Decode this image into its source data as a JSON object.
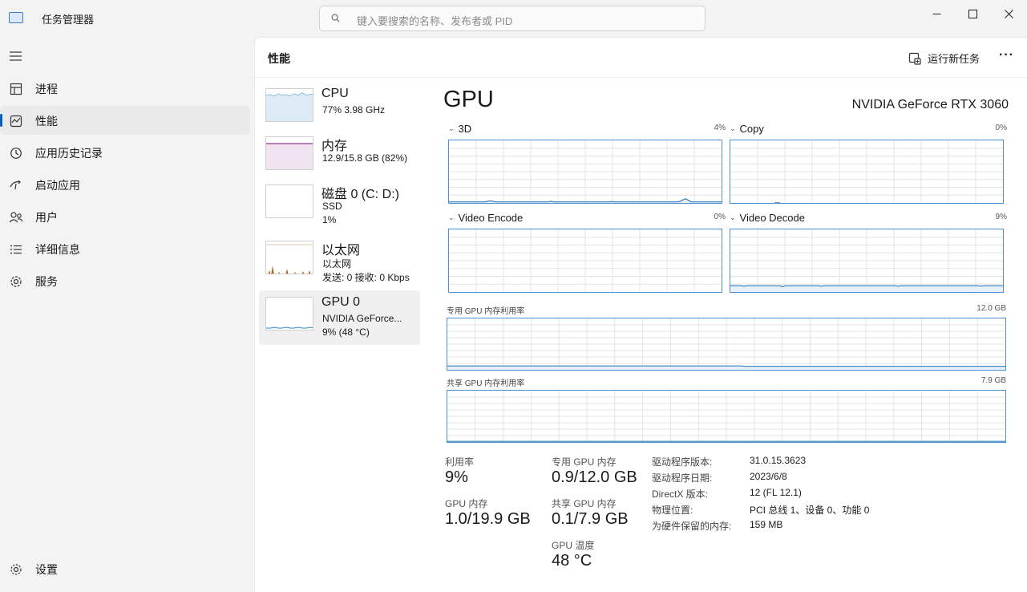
{
  "app": {
    "title": "任务管理器"
  },
  "search": {
    "placeholder": "键入要搜索的名称、发布者或 PID"
  },
  "sidebar": {
    "items": [
      {
        "label": "进程",
        "icon": "processes-icon"
      },
      {
        "label": "性能",
        "icon": "performance-icon"
      },
      {
        "label": "应用历史记录",
        "icon": "app-history-icon"
      },
      {
        "label": "启动应用",
        "icon": "startup-apps-icon"
      },
      {
        "label": "用户",
        "icon": "users-icon"
      },
      {
        "label": "详细信息",
        "icon": "details-icon"
      },
      {
        "label": "服务",
        "icon": "services-icon"
      }
    ],
    "active_index": 1,
    "settings": "设置"
  },
  "header": {
    "title": "性能",
    "run_task": "运行新任务"
  },
  "devices": [
    {
      "name": "CPU",
      "line1": "77%  3.98 GHz",
      "line2": "",
      "color": "#2f89c4"
    },
    {
      "name": "内存",
      "line1": "12.9/15.8 GB (82%)",
      "line2": "",
      "color": "#8e3b8e"
    },
    {
      "name": "磁盘 0 (C: D:)",
      "line1": "SSD",
      "line2": "1%",
      "color": "#4d9b3d"
    },
    {
      "name": "以太网",
      "line1": "以太网",
      "line2": "发送: 0 接收: 0 Kbps",
      "color": "#b5651d"
    },
    {
      "name": "GPU 0",
      "line1": "NVIDIA GeForce...",
      "line2": "9% (48 °C)",
      "color": "#2f89c4"
    }
  ],
  "active_device_index": 4,
  "gpu": {
    "title": "GPU",
    "model": "NVIDIA GeForce RTX 3060",
    "engines": [
      {
        "name": "3D",
        "max": "4%",
        "values": [
          1,
          1,
          1,
          1,
          1,
          1,
          1,
          1,
          1,
          1,
          1,
          1,
          1,
          1,
          1.5,
          2,
          1.5,
          1,
          1,
          1,
          1,
          1,
          1,
          1,
          1,
          1,
          1,
          1,
          1,
          1,
          1,
          1,
          1,
          1,
          1,
          1,
          1,
          1.5,
          1,
          1,
          1,
          1,
          1,
          1,
          1,
          1,
          1,
          1,
          1,
          1,
          1,
          1,
          1,
          1,
          1,
          1,
          1,
          1,
          1,
          1.2,
          1,
          1,
          1,
          1,
          1,
          1,
          1,
          1,
          1,
          1,
          1,
          1,
          1,
          1,
          1,
          1,
          1,
          1,
          1,
          1,
          1,
          1,
          1,
          1,
          1.5,
          3,
          4,
          2.5,
          1,
          1,
          1,
          1,
          1,
          1,
          1,
          1,
          1,
          1,
          1,
          1
        ]
      },
      {
        "name": "Copy",
        "max": "0%",
        "values": []
      },
      {
        "name": "Video Encode",
        "max": "0%",
        "values": []
      },
      {
        "name": "Video Decode",
        "max": "9%",
        "values": [
          6,
          6,
          6,
          6,
          6,
          5.5,
          6,
          6,
          6,
          6,
          6,
          6,
          6,
          6,
          6,
          6,
          6,
          6,
          6,
          5,
          6,
          6,
          6,
          6,
          6,
          6,
          6,
          6,
          6,
          6,
          6,
          6,
          6,
          5.5,
          6,
          6,
          6,
          6,
          6,
          6,
          6,
          6,
          6,
          6,
          6,
          6,
          6,
          6,
          6,
          6,
          6,
          6,
          6,
          6,
          6,
          6,
          6,
          6,
          6,
          6,
          6,
          5.5,
          6,
          6,
          6,
          6,
          6,
          6,
          6,
          6,
          6,
          6,
          6,
          6,
          6,
          6,
          6,
          6,
          6,
          6,
          6,
          6,
          6,
          6,
          6,
          6,
          6,
          6,
          6,
          6,
          6,
          5.5,
          6,
          6,
          6,
          6,
          6,
          6,
          6,
          6
        ]
      }
    ],
    "dedicated_label": "专用 GPU 内存利用率",
    "dedicated_max": "12.0 GB",
    "dedicated_values": [
      0.9,
      0.9,
      0.9,
      0.9,
      0.9,
      0.9,
      0.9,
      0.9,
      0.9,
      0.9,
      0.9,
      0.9,
      0.9,
      0.9,
      0.9,
      0.9,
      0.9,
      0.9,
      0.9,
      0.9,
      0.9,
      0.9,
      0.9,
      0.9,
      0.9,
      0.9,
      0.9,
      0.9,
      0.9,
      0.9,
      0.9,
      0.9,
      0.9,
      0.9,
      0.9,
      0.9,
      0.9,
      0.9,
      0.9,
      0.9,
      0.9,
      0.9,
      0.9,
      0.9,
      0.9,
      0.9,
      0.9,
      0.9,
      0.9,
      0.9,
      0.9,
      0.9,
      0.9,
      0.8,
      0.8,
      0.8,
      0.8,
      0.8,
      0.8,
      0.8,
      0.8,
      0.8,
      0.8,
      0.8,
      0.8,
      0.8,
      0.8,
      0.8,
      0.8,
      0.8,
      0.8,
      0.8,
      0.8,
      0.8,
      0.8,
      0.8,
      0.8,
      0.8,
      0.8,
      0.8,
      0.8,
      0.8,
      0.8,
      0.8,
      0.8,
      0.8,
      0.8,
      0.8,
      0.8,
      0.8,
      0.8,
      0.8,
      0.8,
      0.8,
      0.8,
      0.8,
      0.8,
      0.8,
      0.8,
      0.8
    ],
    "shared_label": "共享 GPU 内存利用率",
    "shared_max": "7.9 GB",
    "shared_values": [
      0.1,
      0.1,
      0.1,
      0.1,
      0.1,
      0.1,
      0.1,
      0.1,
      0.1,
      0.1
    ],
    "stats": {
      "utilization_label": "利用率",
      "utilization": "9%",
      "dedicated_mem_label": "专用 GPU 内存",
      "dedicated_mem": "0.9/12.0 GB",
      "gpu_mem_label": "GPU 内存",
      "gpu_mem": "1.0/19.9 GB",
      "shared_mem_label": "共享 GPU 内存",
      "shared_mem": "0.1/7.9 GB",
      "temp_label": "GPU 温度",
      "temp": "48 °C"
    },
    "info": [
      {
        "k": "驱动程序版本:",
        "v": "31.0.15.3623"
      },
      {
        "k": "驱动程序日期:",
        "v": "2023/6/8"
      },
      {
        "k": "DirectX 版本:",
        "v": "12 (FL 12.1)"
      },
      {
        "k": "物理位置:",
        "v": "PCI 总线 1、设备 0、功能 0"
      },
      {
        "k": "为硬件保留的内存:",
        "v": "159 MB"
      }
    ]
  }
}
